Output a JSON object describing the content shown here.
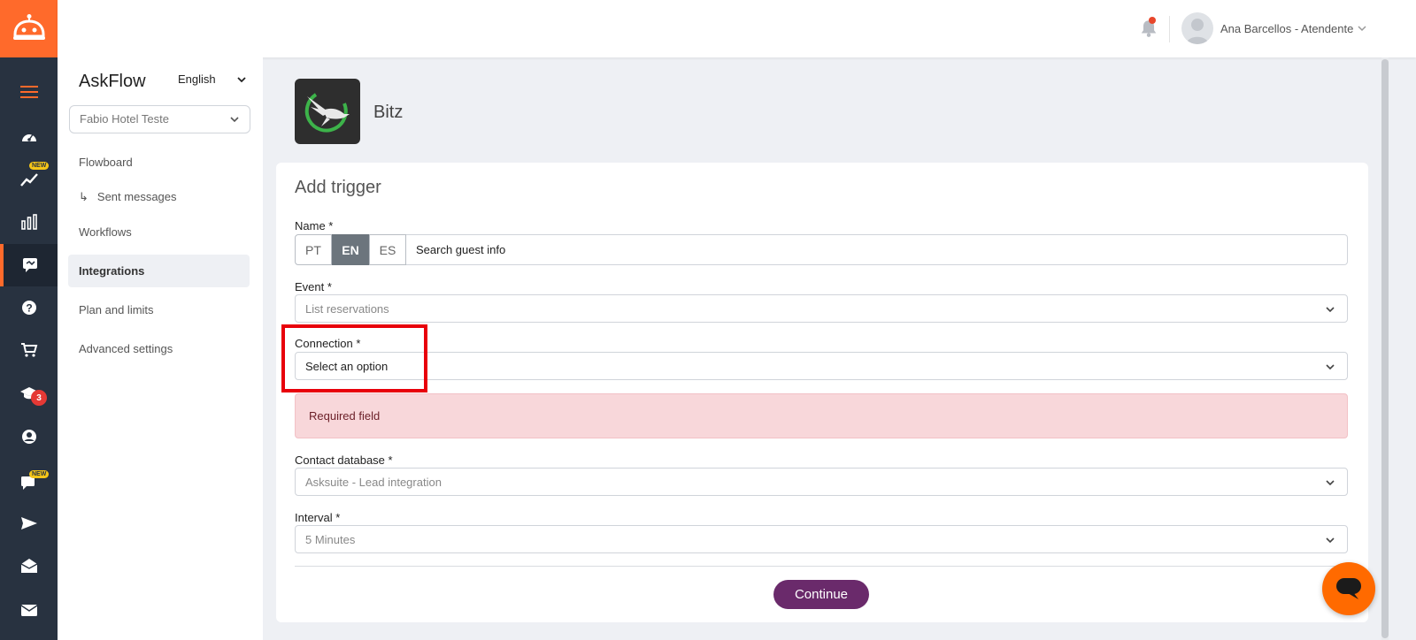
{
  "topbar": {
    "user_name": "Ana Barcellos - Atendente"
  },
  "rail": {
    "badges": {
      "new": "NEW",
      "notifications_count": "3"
    }
  },
  "sidebar": {
    "brand": "AskFlow",
    "language": "English",
    "hotel_select": "Fabio Hotel Teste",
    "items": [
      {
        "label": "Flowboard"
      },
      {
        "label": "Sent messages"
      },
      {
        "label": "Workflows"
      },
      {
        "label": "Integrations"
      },
      {
        "label": "Plan and limits"
      },
      {
        "label": "Advanced settings"
      }
    ]
  },
  "app": {
    "name": "Bitz"
  },
  "form": {
    "title": "Add trigger",
    "name": {
      "label": "Name *",
      "languages": [
        "PT",
        "EN",
        "ES"
      ],
      "value": "Search guest info"
    },
    "event": {
      "label": "Event *",
      "value": "List reservations"
    },
    "connection": {
      "label": "Connection *",
      "value": "Select an option"
    },
    "alert": "Required field",
    "contact_database": {
      "label": "Contact database *",
      "value": "Asksuite - Lead integration"
    },
    "interval": {
      "label": "Interval *",
      "value": "5 Minutes"
    },
    "continue_label": "Continue"
  },
  "colors": {
    "brand_orange": "#ff6a2b",
    "rail_bg": "#283240",
    "continue_purple": "#6a2a6b",
    "alert_bg": "#f8d7da",
    "highlight_red": "#e8000b"
  }
}
